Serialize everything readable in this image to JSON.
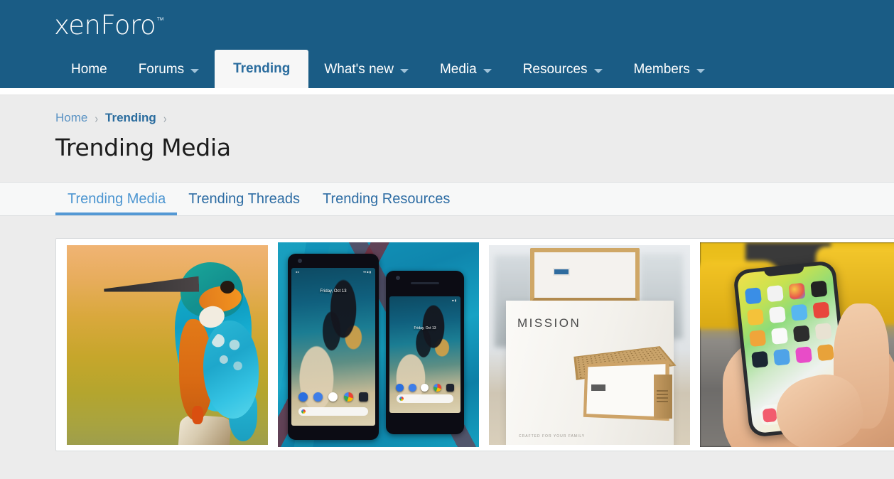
{
  "header": {
    "logo_text": "xenForo",
    "logo_tm": "™",
    "nav": [
      {
        "label": "Home",
        "has_caret": false,
        "active": false
      },
      {
        "label": "Forums",
        "has_caret": true,
        "active": false
      },
      {
        "label": "Trending",
        "has_caret": false,
        "active": true
      },
      {
        "label": "What's new",
        "has_caret": true,
        "active": false
      },
      {
        "label": "Media",
        "has_caret": true,
        "active": false
      },
      {
        "label": "Resources",
        "has_caret": true,
        "active": false
      },
      {
        "label": "Members",
        "has_caret": true,
        "active": false
      }
    ]
  },
  "breadcrumb": {
    "items": [
      {
        "label": "Home",
        "strong": false
      },
      {
        "label": "Trending",
        "strong": true
      }
    ],
    "separator": "›"
  },
  "page_title": "Trending Media",
  "tabs": [
    {
      "label": "Trending Media",
      "active": true
    },
    {
      "label": "Trending Threads",
      "active": false
    },
    {
      "label": "Trending Resources",
      "active": false
    }
  ],
  "media": {
    "items": [
      {
        "name": "kingfisher-bird-photo",
        "kind": "photo"
      },
      {
        "name": "google-pixel-2-phones-photo",
        "kind": "photo",
        "phone_big": {
          "date": "Friday, Oct 13",
          "status_left": "●●",
          "status_right": "▾▾ ■ ▮"
        },
        "phone_small": {
          "date": "Friday, Oct 13",
          "status_right": "■ ▮"
        }
      },
      {
        "name": "mission-speaker-box-photo",
        "kind": "photo",
        "brand": "MISSION",
        "tagline": "CRAFTED FOR YOUR FAMILY"
      },
      {
        "name": "iphone-x-in-hand-photo",
        "kind": "photo"
      }
    ]
  },
  "colors": {
    "header_blue": "#1a5c85",
    "link_blue": "#5b93c4",
    "active_tab_blue": "#4d96d1",
    "page_bg": "#ececec",
    "panel_bg": "#ffffff"
  }
}
